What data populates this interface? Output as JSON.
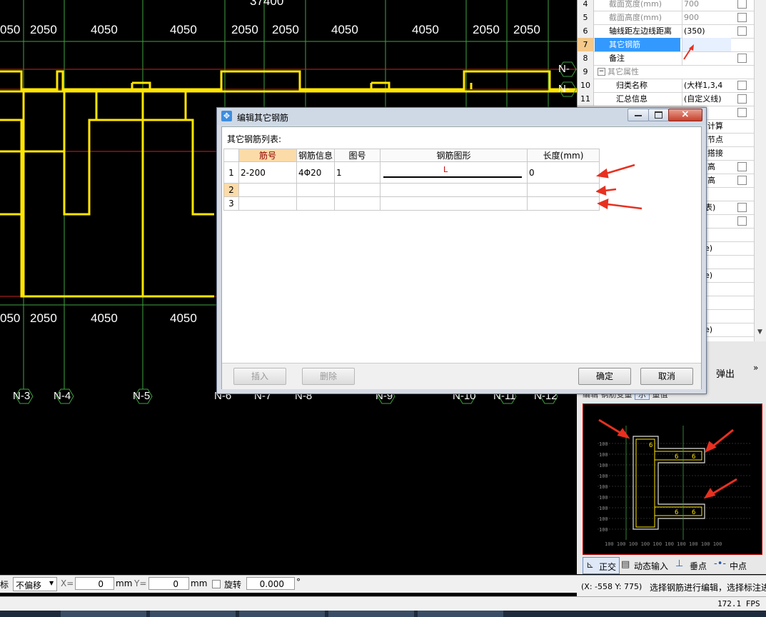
{
  "cad": {
    "top_dims": [
      "050",
      "2050",
      "4050",
      "4050",
      "2050",
      "2050",
      "4050",
      "4050",
      "2050",
      "2050"
    ],
    "top_total": "37400",
    "mid_dims": [
      "050",
      "2050",
      "4050",
      "4050"
    ],
    "axis_labels": [
      "N-3",
      "N-4",
      "N-5",
      "N-6",
      "N-7",
      "N-8",
      "N-9",
      "N-10",
      "N-11",
      "N-12"
    ],
    "right_labels": [
      "N-",
      "N-"
    ]
  },
  "properties": {
    "rows": [
      {
        "num": "4",
        "name": "截面宽度(mm)",
        "value": "700",
        "gray": true,
        "check": true
      },
      {
        "num": "5",
        "name": "截面高度(mm)",
        "value": "900",
        "gray": true,
        "check": true
      },
      {
        "num": "6",
        "name": "轴线距左边线距离",
        "value": "(350)",
        "gray": false,
        "check": true
      },
      {
        "num": "7",
        "name": "其它钢筋",
        "value": "",
        "gray": false,
        "check": false,
        "selected": true
      },
      {
        "num": "8",
        "name": "备注",
        "value": "",
        "gray": false,
        "check": true
      },
      {
        "num": "9",
        "name": "其它属性",
        "value": "",
        "gray": true,
        "check": false,
        "group": true
      },
      {
        "num": "10",
        "name": "归类名称",
        "value": "(大样1,3,4",
        "gray": false,
        "check": true
      },
      {
        "num": "11",
        "name": "汇总信息",
        "value": "(自定义线)",
        "gray": false,
        "check": true
      }
    ],
    "partial_values": [
      "计算",
      "节点",
      "搭接",
      "高",
      "高",
      "表)",
      "e)",
      "e)",
      "e)"
    ]
  },
  "preview": {
    "popout_label": "弹出",
    "tabs": [
      "编辑",
      "钢筋变量",
      "示",
      "量值"
    ],
    "bottom_tools": [
      {
        "label": "正交",
        "icon": "ortho-icon"
      },
      {
        "label": "动态输入",
        "icon": "dynamic-input-icon"
      },
      {
        "label": "垂点",
        "icon": "perpendicular-icon"
      },
      {
        "label": "中点",
        "icon": "midpoint-icon"
      }
    ]
  },
  "bottombar": {
    "left_label": "标",
    "offset_select": "不偏移",
    "x_label": "X=",
    "x_value": "0",
    "x_unit": "mm",
    "y_label": "Y=",
    "y_value": "0",
    "y_unit": "mm",
    "rotate_label": "旋转",
    "rotate_value": "0.000",
    "degree": "°"
  },
  "status": {
    "coords": "(X: -558 Y: 775)",
    "hint": "选择钢筋进行编辑，选择标注进",
    "fps": "172.1 FPS"
  },
  "dialog": {
    "title": "编辑其它钢筋",
    "list_label": "其它钢筋列表:",
    "columns": [
      "筋号",
      "钢筋信息",
      "图号",
      "钢筋图形",
      "长度(mm)"
    ],
    "rows": [
      {
        "n": "1",
        "bar_no": "2-200",
        "info": "4Φ20",
        "fig_no": "1",
        "shape_label": "L",
        "length": "0"
      },
      {
        "n": "2",
        "bar_no": "",
        "info": "",
        "fig_no": "",
        "shape_label": "",
        "length": ""
      },
      {
        "n": "3",
        "bar_no": "",
        "info": "",
        "fig_no": "",
        "shape_label": "",
        "length": ""
      }
    ],
    "buttons": {
      "insert": "插入",
      "delete": "删除",
      "ok": "确定",
      "cancel": "取消"
    }
  },
  "colors": {
    "cad_background": "#000000",
    "beam": "#ffe600",
    "grid_line": "#3fa33f",
    "red_line": "#cc2222",
    "annotation_arrow": "#e83020",
    "selected_row": "#3399ff"
  }
}
